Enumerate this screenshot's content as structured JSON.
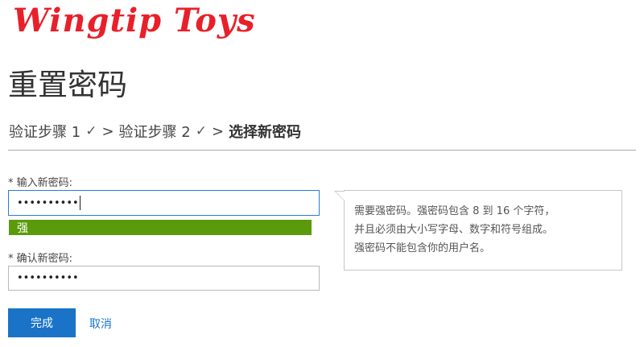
{
  "brand": {
    "logo_text": "Wingtip Toys",
    "logo_color": "#e8202a"
  },
  "page": {
    "title": "重置密码"
  },
  "steps": {
    "step1": "验证步骤 1",
    "step2": "验证步骤 2",
    "current": "选择新密码",
    "check_icon": "check-icon",
    "separator": ">"
  },
  "form": {
    "new_password": {
      "label": "* 输入新密码:",
      "value": "••••••••••"
    },
    "strength": {
      "label": "强",
      "color": "#5a9a0b"
    },
    "confirm_password": {
      "label": "* 确认新密码:",
      "value": "••••••••••"
    }
  },
  "tooltip": {
    "lines": [
      "需要强密码。强密码包含 8 到 16 个字符，",
      "并且必须由大小写字母、数字和符号组成。",
      "强密码不能包含你的用户名。"
    ]
  },
  "actions": {
    "submit_label": "完成",
    "cancel_label": "取消",
    "accent_color": "#1a73c7"
  }
}
